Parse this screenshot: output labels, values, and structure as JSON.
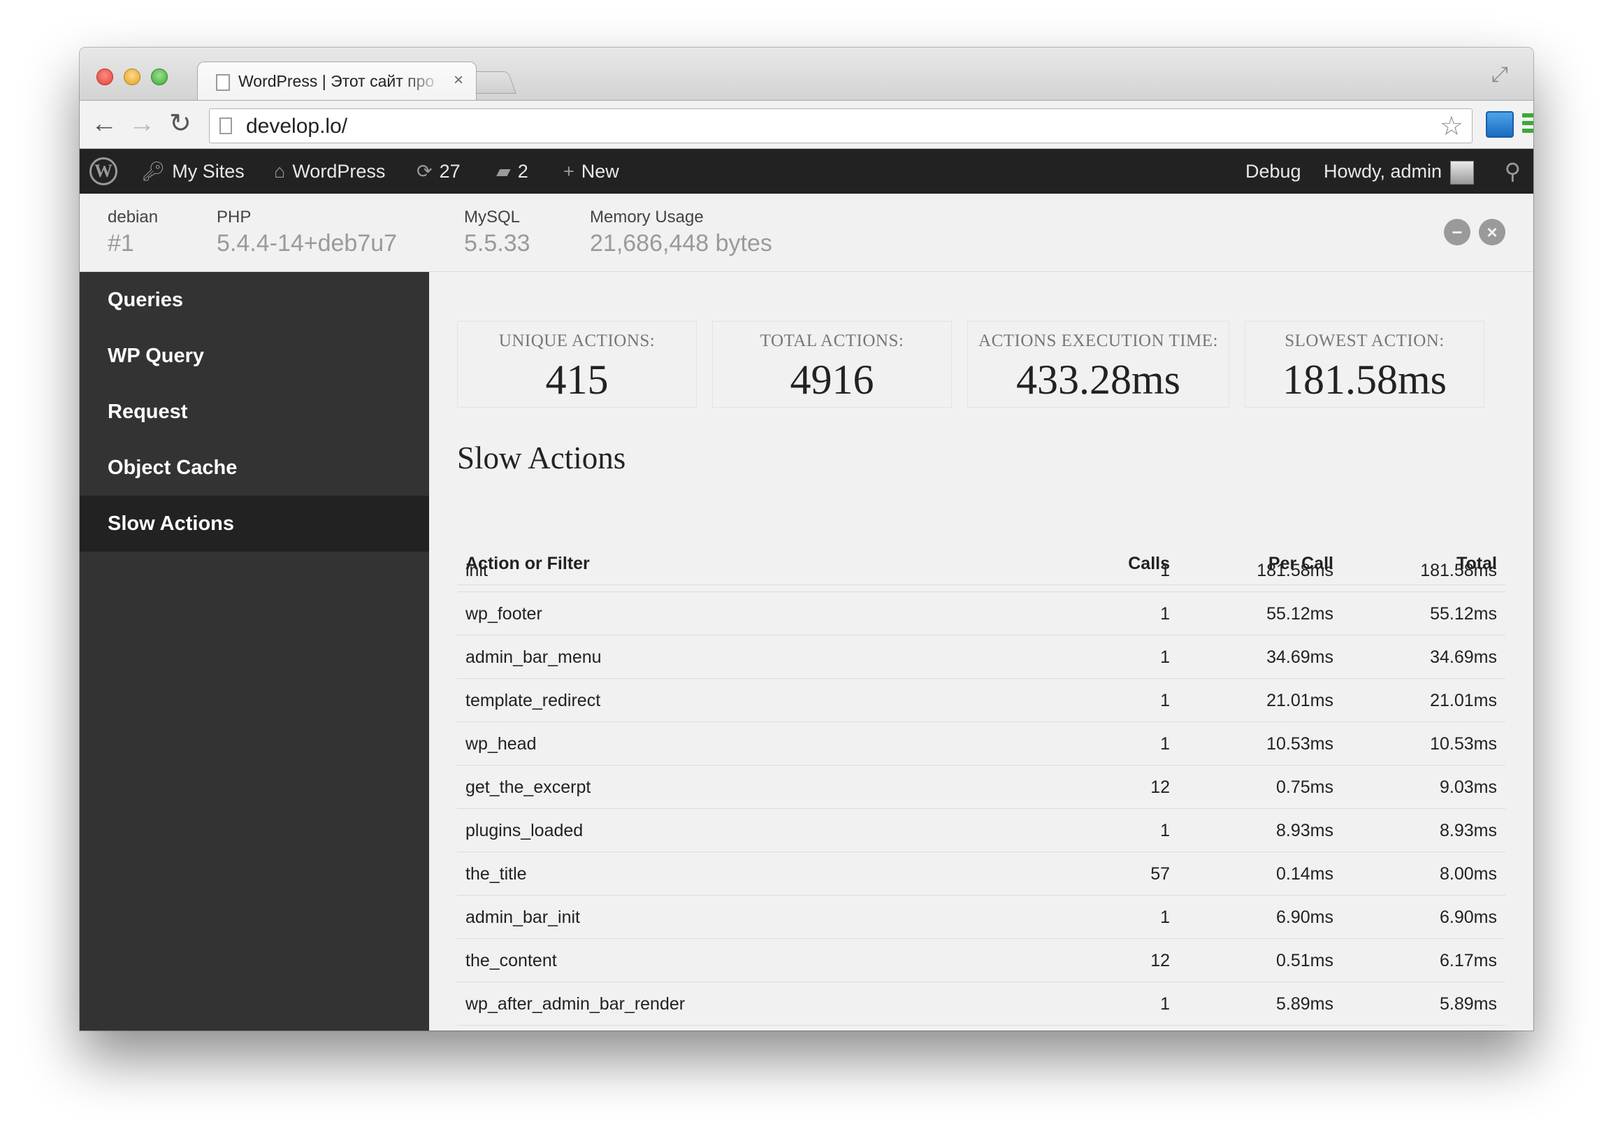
{
  "browser": {
    "tab_title": "WordPress | Этот сайт про",
    "tab_close": "×",
    "url": "develop.lo/"
  },
  "adminbar": {
    "wp_logo": "W",
    "my_sites": "My Sites",
    "site_name": "WordPress",
    "updates_count": "27",
    "comments_count": "2",
    "new_label": "New",
    "debug_label": "Debug",
    "howdy": "Howdy, admin"
  },
  "debug_header": {
    "host_label": "debian",
    "host_value": "#1",
    "php_label": "PHP",
    "php_value": "5.4.4-14+deb7u7",
    "mysql_label": "MySQL",
    "mysql_value": "5.5.33",
    "memory_label": "Memory Usage",
    "memory_value": "21,686,448 bytes"
  },
  "sidebar": {
    "items": [
      {
        "label": "Queries"
      },
      {
        "label": "WP Query"
      },
      {
        "label": "Request"
      },
      {
        "label": "Object Cache"
      },
      {
        "label": "Slow Actions",
        "active": true
      }
    ]
  },
  "stats": [
    {
      "label": "UNIQUE ACTIONS:",
      "value": "415"
    },
    {
      "label": "TOTAL ACTIONS:",
      "value": "4916"
    },
    {
      "label": "ACTIONS EXECUTION TIME:",
      "value": "433.28ms"
    },
    {
      "label": "SLOWEST ACTION:",
      "value": "181.58ms"
    }
  ],
  "section_title": "Slow Actions",
  "table": {
    "headers": {
      "name": "Action or Filter",
      "calls": "Calls",
      "per_call": "Per Call",
      "total": "Total"
    },
    "rows": [
      {
        "name": "init",
        "calls": "1",
        "per_call": "181.58ms",
        "total": "181.58ms"
      },
      {
        "name": "wp_footer",
        "calls": "1",
        "per_call": "55.12ms",
        "total": "55.12ms"
      },
      {
        "name": "admin_bar_menu",
        "calls": "1",
        "per_call": "34.69ms",
        "total": "34.69ms"
      },
      {
        "name": "template_redirect",
        "calls": "1",
        "per_call": "21.01ms",
        "total": "21.01ms"
      },
      {
        "name": "wp_head",
        "calls": "1",
        "per_call": "10.53ms",
        "total": "10.53ms"
      },
      {
        "name": "get_the_excerpt",
        "calls": "12",
        "per_call": "0.75ms",
        "total": "9.03ms"
      },
      {
        "name": "plugins_loaded",
        "calls": "1",
        "per_call": "8.93ms",
        "total": "8.93ms"
      },
      {
        "name": "the_title",
        "calls": "57",
        "per_call": "0.14ms",
        "total": "8.00ms"
      },
      {
        "name": "admin_bar_init",
        "calls": "1",
        "per_call": "6.90ms",
        "total": "6.90ms"
      },
      {
        "name": "the_content",
        "calls": "12",
        "per_call": "0.51ms",
        "total": "6.17ms"
      },
      {
        "name": "wp_after_admin_bar_render",
        "calls": "1",
        "per_call": "5.89ms",
        "total": "5.89ms"
      }
    ]
  }
}
